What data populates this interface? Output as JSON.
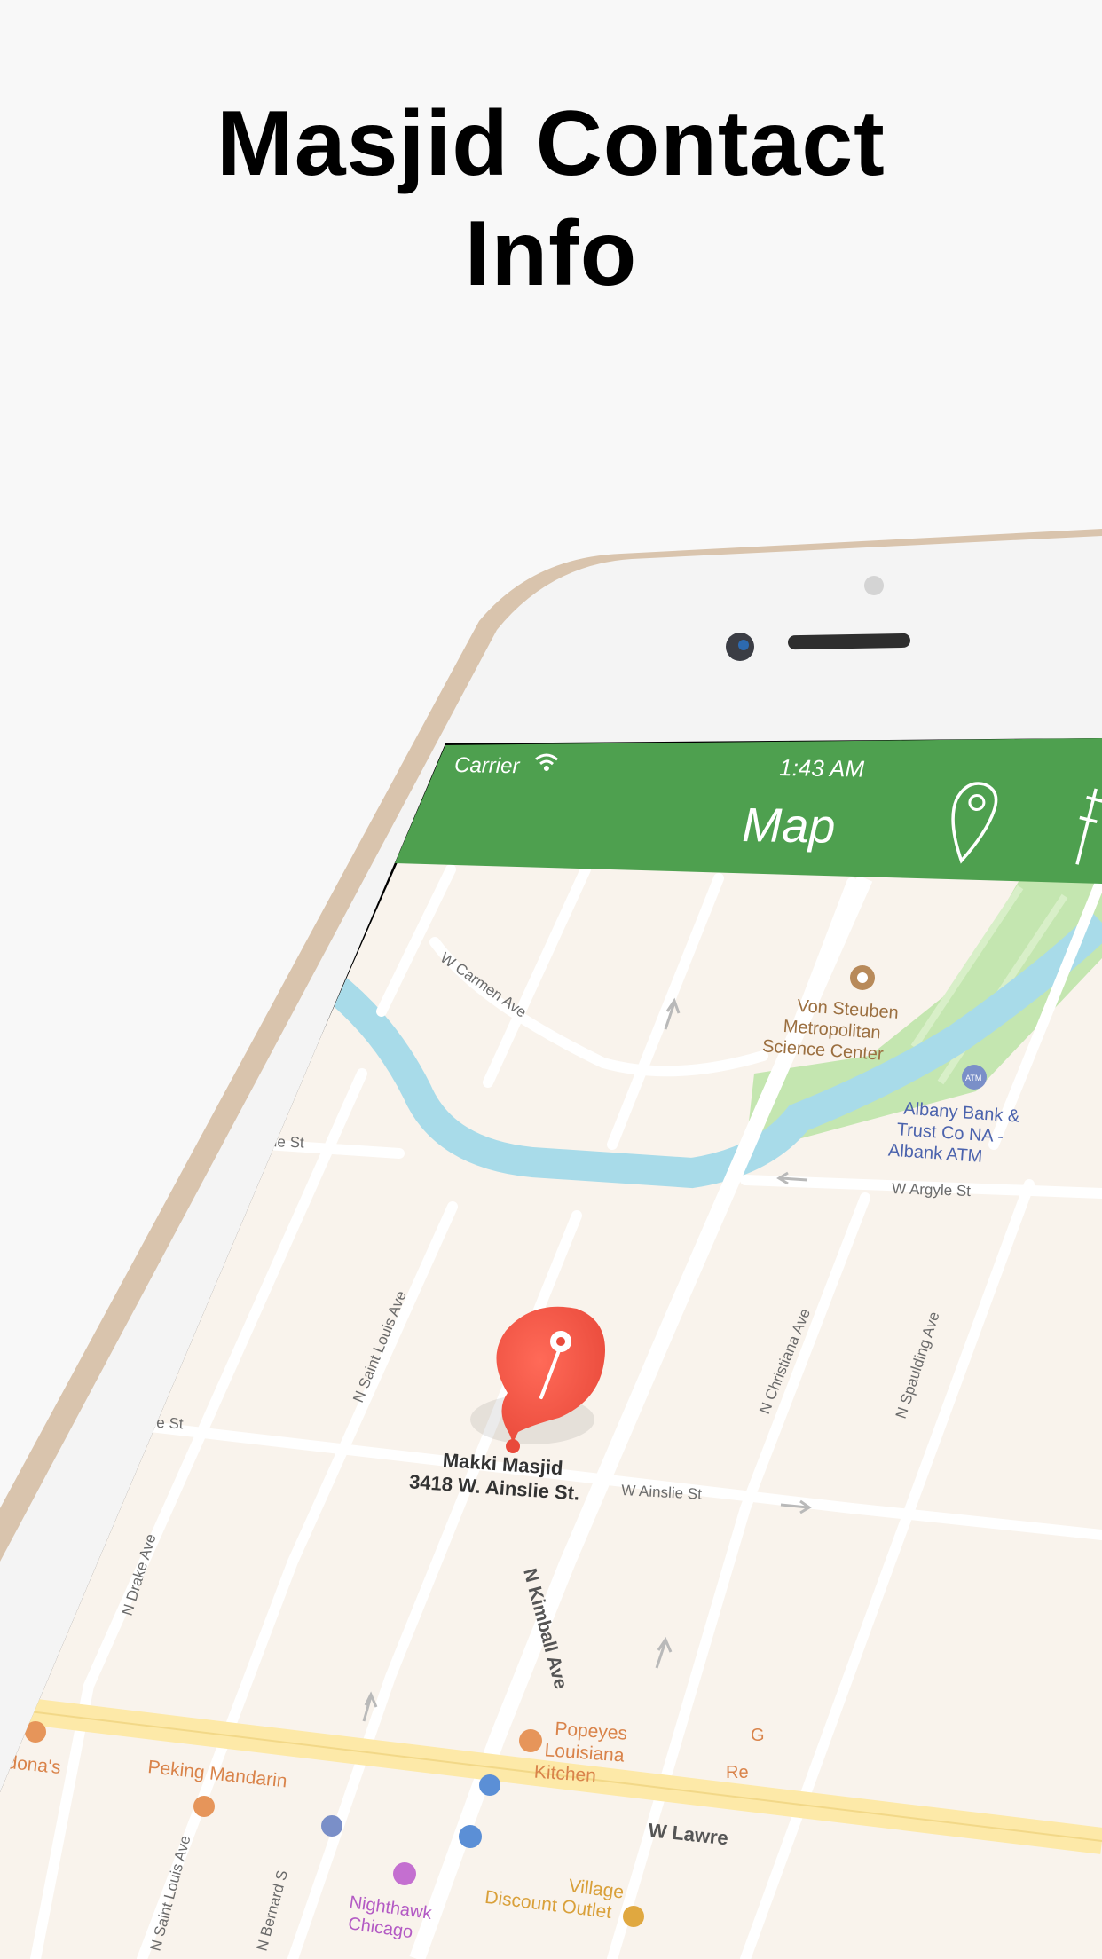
{
  "promo": {
    "headline_line1": "Masjid Contact",
    "headline_line2": "Info"
  },
  "status_bar": {
    "carrier": "Carrier",
    "time": "1:43 AM"
  },
  "nav_bar": {
    "title": "Map",
    "location_icon": "map-pin-icon",
    "right_icon": "signpost-icon",
    "color": "#4ea04f"
  },
  "map": {
    "pin_color": "#f05545",
    "selected_place": {
      "name": "Makki Masjid",
      "address": "3418 W. Ainslie St."
    },
    "street_labels": {
      "w_carmen_ave": "W Carmen Ave",
      "w_argyle_st": "W Argyle St",
      "w_ainslie_st": "W Ainslie St",
      "n_saint_louis_ave": "N Saint Louis Ave",
      "n_christiana_ave": "N Christiana Ave",
      "n_spaulding_ave": "N Spaulding Ave",
      "n_kimball_ave": "N Kimball Ave",
      "n_drake_ave": "N Drake Ave",
      "n_saint_louis_ave_south": "N Saint Louis Ave",
      "n_bernard": "N Bernard S",
      "w_lawrence": "W Lawre",
      "argyle_left": "yle St",
      "ainslie_left": "slie St"
    },
    "pois": {
      "von_steuben_1": "Von Steuben",
      "von_steuben_2": "Metropolitan",
      "von_steuben_3": "Science Center",
      "albany_1": "Albany Bank &",
      "albany_2": "Trust Co NA -",
      "albany_3": "Albank ATM",
      "atm_badge": "ATM",
      "popeyes_1": "Popeyes",
      "popeyes_2": "Louisiana",
      "popeyes_3": "Kitchen",
      "peking": "Peking Mandarin",
      "nighthawk_1": "Nighthawk",
      "nighthawk_2": "Chicago",
      "village_1": "Village",
      "village_2": "Discount Outlet",
      "cardonas": "rdona's",
      "g_partial_1": "G",
      "g_partial_2": "Re"
    }
  }
}
